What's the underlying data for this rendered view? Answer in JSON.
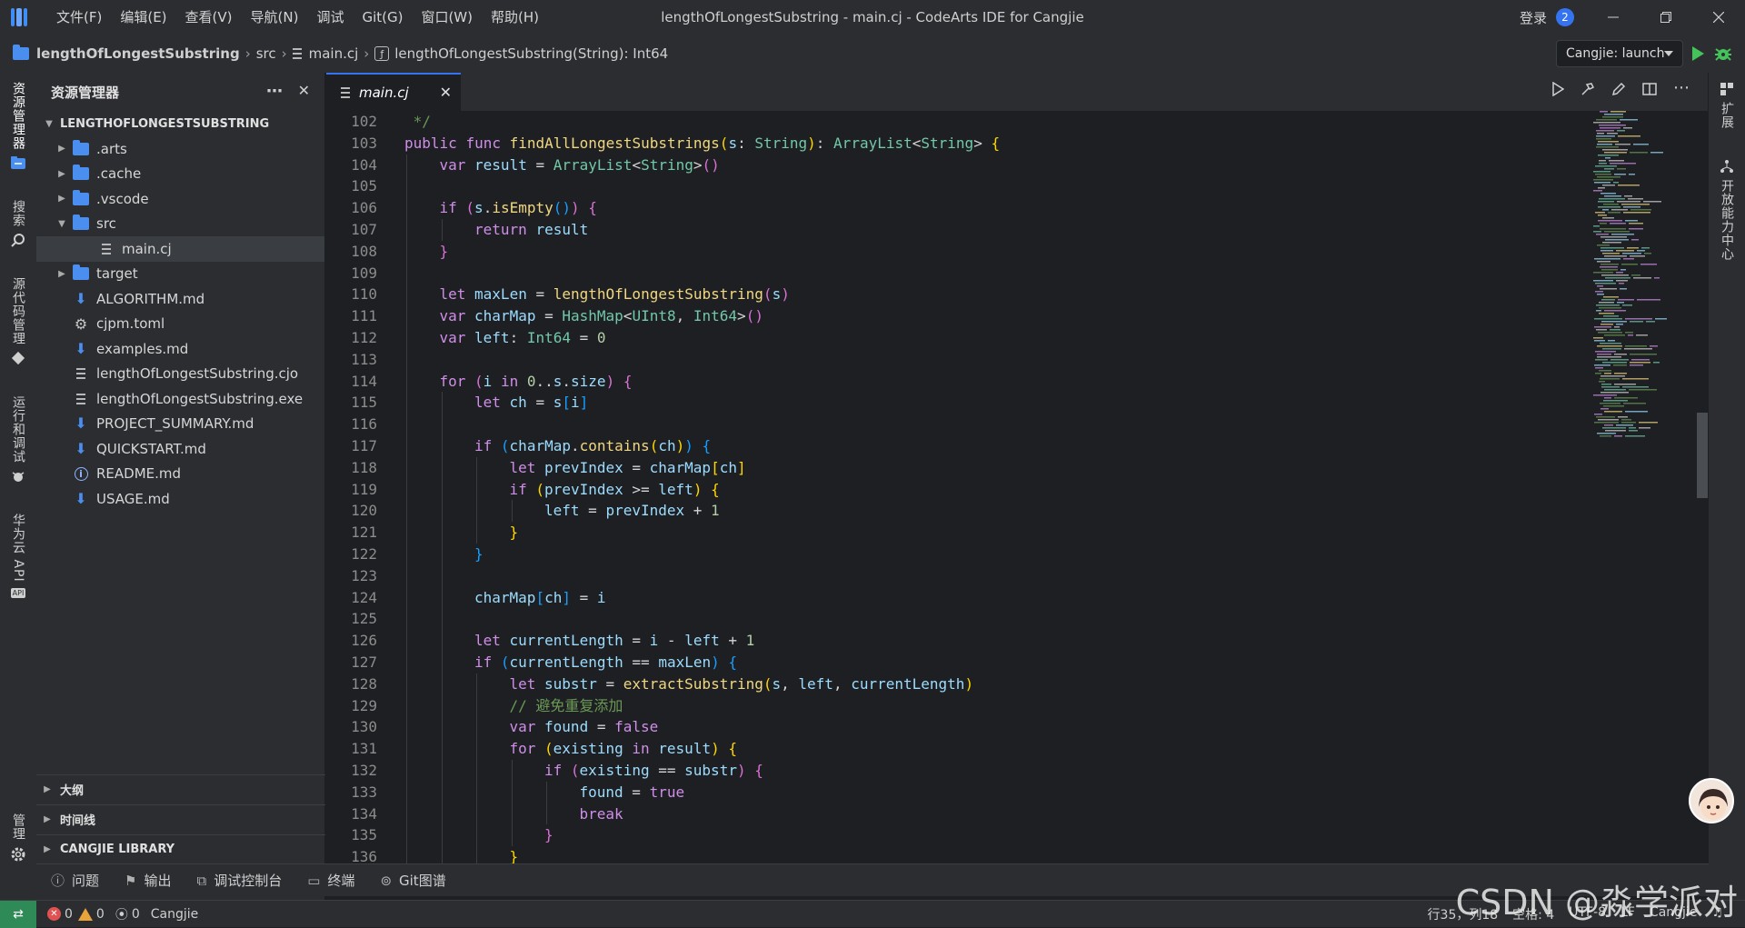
{
  "titlebar": {
    "menu": [
      "文件(F)",
      "编辑(E)",
      "查看(V)",
      "导航(N)",
      "调试",
      "Git(G)",
      "窗口(W)",
      "帮助(H)"
    ],
    "window_title": "lengthOfLongestSubstring - main.cj - CodeArts IDE for Cangjie",
    "login_label": "登录",
    "notification_count": "2"
  },
  "breadcrumb": {
    "project": "lengthOfLongestSubstring",
    "folder": "src",
    "file": "main.cj",
    "symbol": "lengthOfLongestSubstring(String): Int64",
    "run_config": "Cangjie: launch"
  },
  "activitybar": {
    "explorer": "资源管理器",
    "search": "搜索",
    "scm": "源代码管理",
    "run_debug": "运行和调试",
    "huawei_api": "华为云 API",
    "manage": "管理"
  },
  "rightbar": {
    "extensions": "扩展",
    "open_center": "开放能力中心"
  },
  "sidebar": {
    "title": "资源管理器",
    "root": "LENGTHOFLONGESTSUBSTRING",
    "items": [
      {
        "label": ".arts",
        "kind": "folder",
        "expandable": true
      },
      {
        "label": ".cache",
        "kind": "folder",
        "expandable": true
      },
      {
        "label": ".vscode",
        "kind": "folder",
        "expandable": true
      },
      {
        "label": "src",
        "kind": "folder-open",
        "expandable": true
      },
      {
        "label": "main.cj",
        "kind": "file",
        "expandable": false,
        "selected": true
      },
      {
        "label": "target",
        "kind": "folder",
        "expandable": true
      },
      {
        "label": "ALGORITHM.md",
        "kind": "md",
        "expandable": false
      },
      {
        "label": "cjpm.toml",
        "kind": "gear",
        "expandable": false
      },
      {
        "label": "examples.md",
        "kind": "md",
        "expandable": false
      },
      {
        "label": "lengthOfLongestSubstring.cjo",
        "kind": "file",
        "expandable": false
      },
      {
        "label": "lengthOfLongestSubstring.exe",
        "kind": "file",
        "expandable": false
      },
      {
        "label": "PROJECT_SUMMARY.md",
        "kind": "md",
        "expandable": false
      },
      {
        "label": "QUICKSTART.md",
        "kind": "md",
        "expandable": false
      },
      {
        "label": "README.md",
        "kind": "info",
        "expandable": false
      },
      {
        "label": "USAGE.md",
        "kind": "md",
        "expandable": false
      }
    ],
    "sections": [
      "大纲",
      "时间线",
      "CANGJIE LIBRARY"
    ]
  },
  "editor": {
    "tab_label": "main.cj",
    "lines": [
      {
        "n": "102",
        "indent": 0,
        "tokens": [
          [
            " */",
            "cm"
          ]
        ]
      },
      {
        "n": "103",
        "indent": 0,
        "tokens": [
          [
            "public ",
            "kw"
          ],
          [
            "func ",
            "kw"
          ],
          [
            "findAllLongestSubstrings",
            "fn"
          ],
          [
            "(",
            "b1"
          ],
          [
            "s",
            "id"
          ],
          [
            ": ",
            "op"
          ],
          [
            "String",
            "ty"
          ],
          [
            ")",
            "b1"
          ],
          [
            ": ",
            "op"
          ],
          [
            "ArrayList",
            "ty"
          ],
          [
            "<",
            "op"
          ],
          [
            "String",
            "ty"
          ],
          [
            "> ",
            "op"
          ],
          [
            "{",
            "b1"
          ]
        ]
      },
      {
        "n": "104",
        "indent": 1,
        "tokens": [
          [
            "var ",
            "kw"
          ],
          [
            "result ",
            "id"
          ],
          [
            "= ",
            "op"
          ],
          [
            "ArrayList",
            "ty"
          ],
          [
            "<",
            "op"
          ],
          [
            "String",
            "ty"
          ],
          [
            ">",
            "op"
          ],
          [
            "()",
            "b2"
          ]
        ]
      },
      {
        "n": "105",
        "indent": 1,
        "tokens": []
      },
      {
        "n": "106",
        "indent": 1,
        "tokens": [
          [
            "if ",
            "kw"
          ],
          [
            "(",
            "b2"
          ],
          [
            "s",
            "id"
          ],
          [
            ".",
            "op"
          ],
          [
            "isEmpty",
            "fn"
          ],
          [
            "()",
            "b3"
          ],
          [
            ") ",
            "b2"
          ],
          [
            "{",
            "b2"
          ]
        ]
      },
      {
        "n": "107",
        "indent": 2,
        "tokens": [
          [
            "return ",
            "kw"
          ],
          [
            "result",
            "id"
          ]
        ]
      },
      {
        "n": "108",
        "indent": 1,
        "tokens": [
          [
            "}",
            "b2"
          ]
        ]
      },
      {
        "n": "109",
        "indent": 1,
        "tokens": []
      },
      {
        "n": "110",
        "indent": 1,
        "tokens": [
          [
            "let ",
            "kw"
          ],
          [
            "maxLen ",
            "id"
          ],
          [
            "= ",
            "op"
          ],
          [
            "lengthOfLongestSubstring",
            "fn"
          ],
          [
            "(",
            "b2"
          ],
          [
            "s",
            "id"
          ],
          [
            ")",
            "b2"
          ]
        ]
      },
      {
        "n": "111",
        "indent": 1,
        "tokens": [
          [
            "var ",
            "kw"
          ],
          [
            "charMap ",
            "id"
          ],
          [
            "= ",
            "op"
          ],
          [
            "HashMap",
            "ty"
          ],
          [
            "<",
            "op"
          ],
          [
            "UInt8",
            "ty"
          ],
          [
            ", ",
            "op"
          ],
          [
            "Int64",
            "ty"
          ],
          [
            ">",
            "op"
          ],
          [
            "()",
            "b2"
          ]
        ]
      },
      {
        "n": "112",
        "indent": 1,
        "tokens": [
          [
            "var ",
            "kw"
          ],
          [
            "left",
            "id"
          ],
          [
            ": ",
            "op"
          ],
          [
            "Int64 ",
            "ty"
          ],
          [
            "= ",
            "op"
          ],
          [
            "0",
            "num"
          ]
        ]
      },
      {
        "n": "113",
        "indent": 1,
        "tokens": []
      },
      {
        "n": "114",
        "indent": 1,
        "tokens": [
          [
            "for ",
            "kw"
          ],
          [
            "(",
            "b2"
          ],
          [
            "i ",
            "id"
          ],
          [
            "in ",
            "kw"
          ],
          [
            "0",
            "num"
          ],
          [
            "..",
            "op"
          ],
          [
            "s",
            "id"
          ],
          [
            ".",
            "op"
          ],
          [
            "size",
            "id"
          ],
          [
            ") ",
            "b2"
          ],
          [
            "{",
            "b2"
          ]
        ]
      },
      {
        "n": "115",
        "indent": 2,
        "tokens": [
          [
            "let ",
            "kw"
          ],
          [
            "ch ",
            "id"
          ],
          [
            "= ",
            "op"
          ],
          [
            "s",
            "id"
          ],
          [
            "[",
            "b3"
          ],
          [
            "i",
            "id"
          ],
          [
            "]",
            "b3"
          ]
        ]
      },
      {
        "n": "116",
        "indent": 2,
        "tokens": []
      },
      {
        "n": "117",
        "indent": 2,
        "tokens": [
          [
            "if ",
            "kw"
          ],
          [
            "(",
            "b3"
          ],
          [
            "charMap",
            "id"
          ],
          [
            ".",
            "op"
          ],
          [
            "contains",
            "fn"
          ],
          [
            "(",
            "b1"
          ],
          [
            "ch",
            "id"
          ],
          [
            ")",
            "b1"
          ],
          [
            ") ",
            "b3"
          ],
          [
            "{",
            "b3"
          ]
        ]
      },
      {
        "n": "118",
        "indent": 3,
        "tokens": [
          [
            "let ",
            "kw"
          ],
          [
            "prevIndex ",
            "id"
          ],
          [
            "= ",
            "op"
          ],
          [
            "charMap",
            "id"
          ],
          [
            "[",
            "b1"
          ],
          [
            "ch",
            "id"
          ],
          [
            "]",
            "b1"
          ]
        ]
      },
      {
        "n": "119",
        "indent": 3,
        "tokens": [
          [
            "if ",
            "kw"
          ],
          [
            "(",
            "b1"
          ],
          [
            "prevIndex ",
            "id"
          ],
          [
            ">= ",
            "op"
          ],
          [
            "left",
            "id"
          ],
          [
            ") ",
            "b1"
          ],
          [
            "{",
            "b1"
          ]
        ]
      },
      {
        "n": "120",
        "indent": 4,
        "tokens": [
          [
            "left ",
            "id"
          ],
          [
            "= ",
            "op"
          ],
          [
            "prevIndex ",
            "id"
          ],
          [
            "+ ",
            "op"
          ],
          [
            "1",
            "num"
          ]
        ]
      },
      {
        "n": "121",
        "indent": 3,
        "tokens": [
          [
            "}",
            "b1"
          ]
        ]
      },
      {
        "n": "122",
        "indent": 2,
        "tokens": [
          [
            "}",
            "b3"
          ]
        ]
      },
      {
        "n": "123",
        "indent": 2,
        "tokens": []
      },
      {
        "n": "124",
        "indent": 2,
        "tokens": [
          [
            "charMap",
            "id"
          ],
          [
            "[",
            "b3"
          ],
          [
            "ch",
            "id"
          ],
          [
            "] ",
            "b3"
          ],
          [
            "= ",
            "op"
          ],
          [
            "i",
            "id"
          ]
        ]
      },
      {
        "n": "125",
        "indent": 2,
        "tokens": []
      },
      {
        "n": "126",
        "indent": 2,
        "tokens": [
          [
            "let ",
            "kw"
          ],
          [
            "currentLength ",
            "id"
          ],
          [
            "= ",
            "op"
          ],
          [
            "i ",
            "id"
          ],
          [
            "- ",
            "op"
          ],
          [
            "left ",
            "id"
          ],
          [
            "+ ",
            "op"
          ],
          [
            "1",
            "num"
          ]
        ]
      },
      {
        "n": "127",
        "indent": 2,
        "tokens": [
          [
            "if ",
            "kw"
          ],
          [
            "(",
            "b3"
          ],
          [
            "currentLength ",
            "id"
          ],
          [
            "== ",
            "op"
          ],
          [
            "maxLen",
            "id"
          ],
          [
            ") ",
            "b3"
          ],
          [
            "{",
            "b3"
          ]
        ]
      },
      {
        "n": "128",
        "indent": 3,
        "tokens": [
          [
            "let ",
            "kw"
          ],
          [
            "substr ",
            "id"
          ],
          [
            "= ",
            "op"
          ],
          [
            "extractSubstring",
            "fn"
          ],
          [
            "(",
            "b1"
          ],
          [
            "s",
            "id"
          ],
          [
            ", ",
            "op"
          ],
          [
            "left",
            "id"
          ],
          [
            ", ",
            "op"
          ],
          [
            "currentLength",
            "id"
          ],
          [
            ")",
            "b1"
          ]
        ]
      },
      {
        "n": "129",
        "indent": 3,
        "tokens": [
          [
            "// 避免重复添加",
            "cm"
          ]
        ]
      },
      {
        "n": "130",
        "indent": 3,
        "tokens": [
          [
            "var ",
            "kw"
          ],
          [
            "found ",
            "id"
          ],
          [
            "= ",
            "op"
          ],
          [
            "false",
            "kw"
          ]
        ]
      },
      {
        "n": "131",
        "indent": 3,
        "tokens": [
          [
            "for ",
            "kw"
          ],
          [
            "(",
            "b1"
          ],
          [
            "existing ",
            "id"
          ],
          [
            "in ",
            "kw"
          ],
          [
            "result",
            "id"
          ],
          [
            ") ",
            "b1"
          ],
          [
            "{",
            "b1"
          ]
        ]
      },
      {
        "n": "132",
        "indent": 4,
        "tokens": [
          [
            "if ",
            "kw"
          ],
          [
            "(",
            "b2"
          ],
          [
            "existing ",
            "id"
          ],
          [
            "== ",
            "op"
          ],
          [
            "substr",
            "id"
          ],
          [
            ") ",
            "b2"
          ],
          [
            "{",
            "b2"
          ]
        ]
      },
      {
        "n": "133",
        "indent": 5,
        "tokens": [
          [
            "found ",
            "id"
          ],
          [
            "= ",
            "op"
          ],
          [
            "true",
            "kw"
          ]
        ]
      },
      {
        "n": "134",
        "indent": 5,
        "tokens": [
          [
            "break",
            "kw"
          ]
        ]
      },
      {
        "n": "135",
        "indent": 4,
        "tokens": [
          [
            "}",
            "b2"
          ]
        ]
      },
      {
        "n": "136",
        "indent": 3,
        "tokens": [
          [
            "}",
            "b1"
          ]
        ]
      }
    ]
  },
  "panel": {
    "tabs": [
      "问题",
      "输出",
      "调试控制台",
      "终端",
      "Git图谱"
    ]
  },
  "statusbar": {
    "errors": "0",
    "warnings": "0",
    "ports": "0",
    "language": "Cangjie",
    "position": "行35，列18",
    "indent": "空格: 4",
    "encoding": "UTF-8",
    "eol": "LF",
    "mode": "Cangjie"
  },
  "watermark": "CSDN @淼学派对",
  "colors": {
    "accent": "#3574f0",
    "folder": "#4a8ff0",
    "remote": "#2e8b57",
    "error": "#e05252",
    "warning": "#e8a33a"
  }
}
